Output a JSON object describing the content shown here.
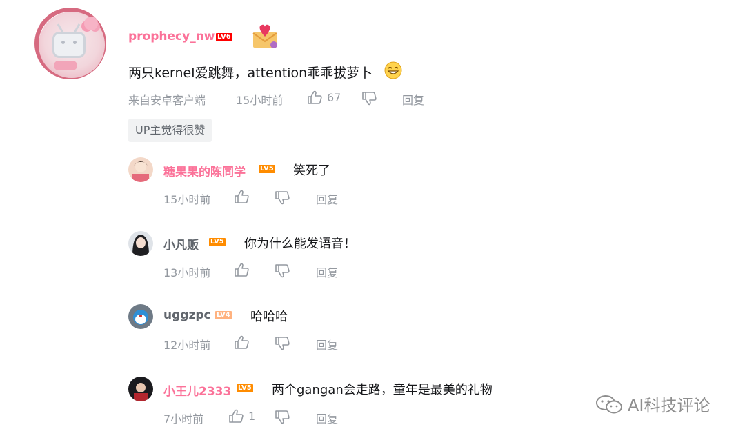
{
  "main_comment": {
    "username": "prophecy_nw",
    "level": "LV6",
    "content": "两只kernel爱跳舞，attention乖乖拔萝卜",
    "source": "来自安卓客户端",
    "time": "15小时前",
    "likes": "67",
    "reply_label": "回复",
    "up_tag": "UP主觉得很赞"
  },
  "replies": [
    {
      "username": "糖果果的陈同学",
      "level": "LV5",
      "content": "笑死了",
      "time": "15小时前",
      "likes": "",
      "reply_label": "回复",
      "name_color": "#fb7299"
    },
    {
      "username": "小凡贩",
      "level": "LV5",
      "content": "你为什么能发语音！",
      "time": "13小时前",
      "likes": "",
      "reply_label": "回复",
      "name_color": "#61666d"
    },
    {
      "username": "uggzpc",
      "level": "LV4",
      "content": "哈哈哈",
      "time": "12小时前",
      "likes": "",
      "reply_label": "回复",
      "name_color": "#61666d"
    },
    {
      "username": "小王儿2333",
      "level": "LV5",
      "content": "两个gangan会走路，童年是最美的礼物",
      "time": "7小时前",
      "likes": "1",
      "reply_label": "回复",
      "name_color": "#fb7299"
    }
  ],
  "watermark": "AI科技评论",
  "colors": {
    "pink": "#fb7299",
    "gray_text": "#9499a0",
    "lv6": "#ff0000",
    "lv5": "#ff8c00",
    "lv4": "#ffb27f"
  }
}
